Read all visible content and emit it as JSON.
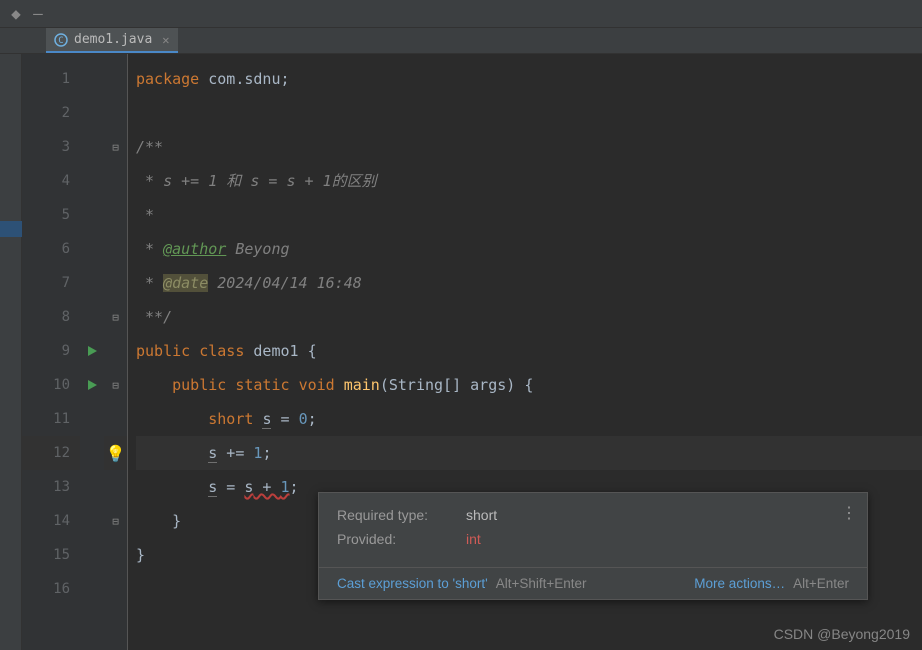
{
  "tab": {
    "filename": "demo1.java"
  },
  "lines": [
    "1",
    "2",
    "3",
    "4",
    "5",
    "6",
    "7",
    "8",
    "9",
    "10",
    "11",
    "12",
    "13",
    "14",
    "15",
    "16"
  ],
  "code": {
    "l1_kw": "package",
    "l1_pkg": " com.sdnu",
    "l1_semi": ";",
    "l3": "/**",
    "l4": " * s += 1 和 s = s + 1的区别",
    "l5": " *",
    "l6_pre": " * ",
    "l6_tag": "@author",
    "l6_name": " Beyong",
    "l7_pre": " * ",
    "l7_tag": "@date",
    "l7_date": " 2024/04/14 16:48",
    "l8": " **/",
    "l9_public": "public ",
    "l9_class": "class ",
    "l9_name": "demo1 ",
    "l9_brace": "{",
    "l10_indent": "    ",
    "l10_public": "public ",
    "l10_static": "static ",
    "l10_void": "void ",
    "l10_main": "main",
    "l10_args": "(String[] args) {",
    "l11_indent": "        ",
    "l11_short": "short ",
    "l11_s": "s",
    "l11_eq": " = ",
    "l11_zero": "0",
    "l11_semi": ";",
    "l12_indent": "        ",
    "l12_s": "s",
    "l12_op": " += ",
    "l12_one": "1",
    "l12_semi": ";",
    "l13_indent": "        ",
    "l13_s": "s",
    "l13_eq": " = ",
    "l13_s2": "s",
    "l13_plus": " + ",
    "l13_one": "1",
    "l13_semi": ";",
    "l14": "    }",
    "l15": "}"
  },
  "tooltip": {
    "required_label": "Required type:",
    "required_value": "short",
    "provided_label": "Provided:",
    "provided_value": "int",
    "cast_action": "Cast expression to 'short'",
    "cast_shortcut": "Alt+Shift+Enter",
    "more_actions": "More actions…",
    "more_shortcut": "Alt+Enter"
  },
  "watermark": "CSDN @Beyong2019"
}
